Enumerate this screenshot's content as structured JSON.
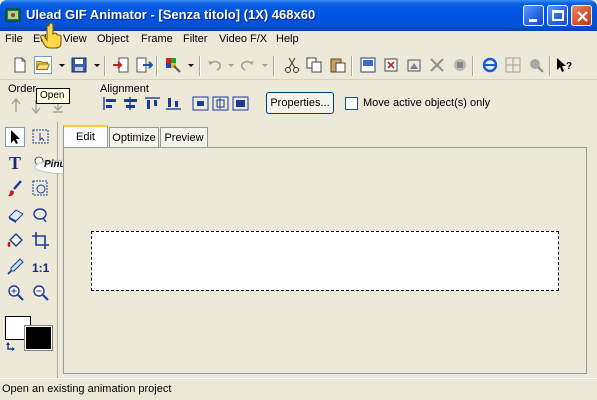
{
  "window": {
    "title": "Ulead GIF Animator - [Senza titolo] (1X) 468x60",
    "buttons": [
      "minimize",
      "maximize",
      "close"
    ]
  },
  "menu": {
    "items": [
      "File",
      "Edit",
      "View",
      "Object",
      "Frame",
      "Filter",
      "Video F/X",
      "Help"
    ]
  },
  "tooltip": {
    "text": "Open"
  },
  "toolbar2": {
    "order_label": "Order",
    "alignment_label": "Alignment",
    "properties_label": "Properties...",
    "move_active_label": "Move active object(s) only",
    "move_active_checked": false
  },
  "tabs": {
    "items": [
      "Edit",
      "Optimize",
      "Preview"
    ],
    "active": "Edit"
  },
  "tools": {
    "labels": [
      "1:1"
    ],
    "watermark": "Pinuccia"
  },
  "canvas": {
    "width": 468,
    "height": 60
  },
  "status": {
    "text": "Open an existing animation project"
  },
  "colors": {
    "titlebar": "#0054e3",
    "face": "#ece9d8",
    "foreground_color": "#ffffff",
    "background_color": "#000000"
  }
}
